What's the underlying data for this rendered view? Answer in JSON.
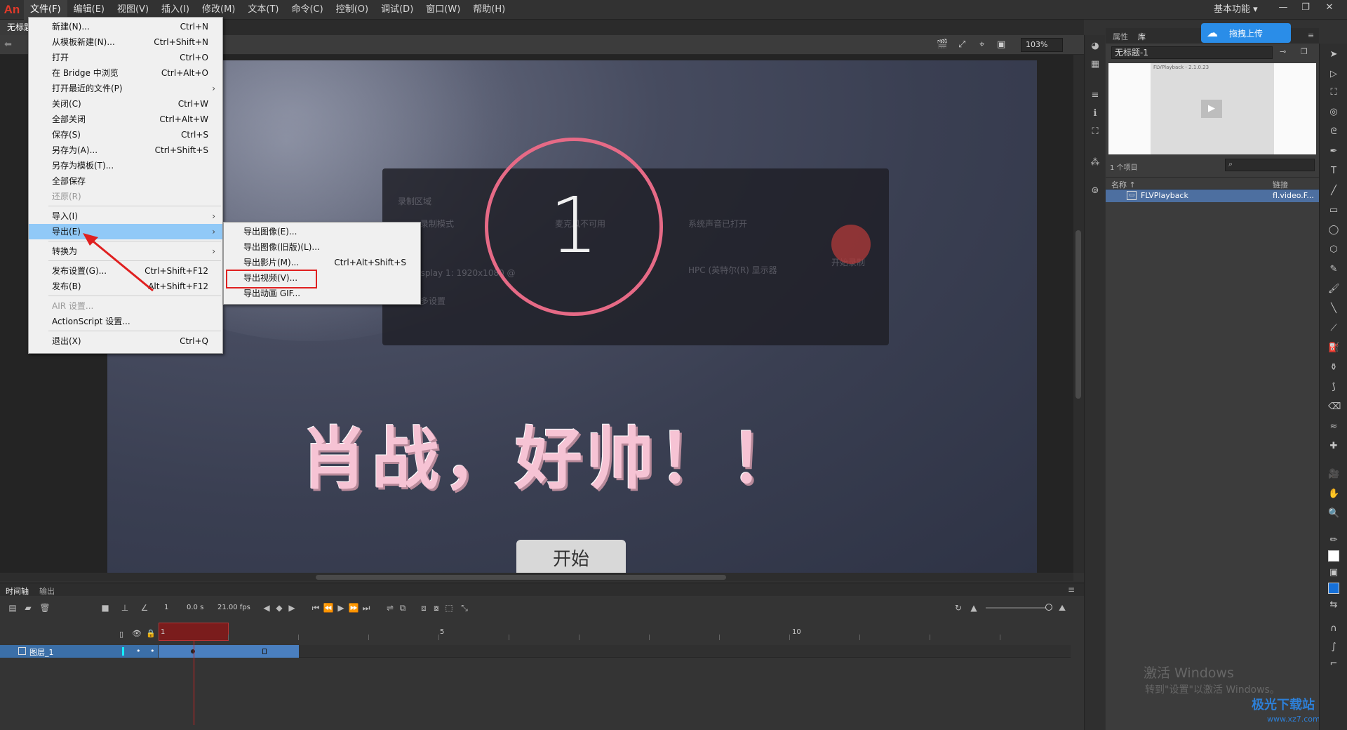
{
  "app": {
    "logo": "An"
  },
  "menubar": {
    "items": [
      "文件(F)",
      "编辑(E)",
      "视图(V)",
      "插入(I)",
      "修改(M)",
      "文本(T)",
      "命令(C)",
      "控制(O)",
      "调试(D)",
      "窗口(W)",
      "帮助(H)"
    ],
    "workspace": "基本功能",
    "workspace_arrow": "▾"
  },
  "document": {
    "tab_title": "无标题-1",
    "zoom": "103%"
  },
  "file_menu": {
    "items": [
      {
        "label": "新建(N)...",
        "shortcut": "Ctrl+N"
      },
      {
        "label": "从模板新建(N)...",
        "shortcut": "Ctrl+Shift+N"
      },
      {
        "label": "打开",
        "shortcut": "Ctrl+O"
      },
      {
        "label": "在 Bridge 中浏览",
        "shortcut": "Ctrl+Alt+O"
      },
      {
        "label": "打开最近的文件(P)",
        "shortcut": ""
      },
      {
        "label": "关闭(C)",
        "shortcut": "Ctrl+W"
      },
      {
        "label": "全部关闭",
        "shortcut": "Ctrl+Alt+W"
      },
      {
        "label": "保存(S)",
        "shortcut": "Ctrl+S"
      },
      {
        "label": "另存为(A)...",
        "shortcut": "Ctrl+Shift+S"
      },
      {
        "label": "另存为模板(T)...",
        "shortcut": ""
      },
      {
        "label": "全部保存",
        "shortcut": ""
      },
      {
        "label": "还原(R)",
        "shortcut": ""
      },
      {
        "label": "导入(I)",
        "shortcut": ""
      },
      {
        "label": "导出(E)",
        "shortcut": ""
      },
      {
        "label": "转换为",
        "shortcut": ""
      },
      {
        "label": "发布设置(G)...",
        "shortcut": "Ctrl+Shift+F12"
      },
      {
        "label": "发布(B)",
        "shortcut": "Alt+Shift+F12"
      },
      {
        "label": "AIR 设置...",
        "shortcut": ""
      },
      {
        "label": "ActionScript 设置...",
        "shortcut": ""
      },
      {
        "label": "退出(X)",
        "shortcut": "Ctrl+Q"
      }
    ],
    "submenu_arrow": "›"
  },
  "export_menu": {
    "items": [
      {
        "label": "导出图像(E)...",
        "shortcut": ""
      },
      {
        "label": "导出图像(旧版)(L)...",
        "shortcut": ""
      },
      {
        "label": "导出影片(M)...",
        "shortcut": "Ctrl+Alt+Shift+S"
      },
      {
        "label": "导出视频(V)...",
        "shortcut": ""
      },
      {
        "label": "导出动画 GIF...",
        "shortcut": ""
      }
    ]
  },
  "stage": {
    "countdown": "1",
    "hero_text": "肖战，好帅！！",
    "start_button": "开始",
    "bg_panel_text": [
      "录制区域",
      "录制模式",
      "麦克风不可用",
      "系统声音已打开",
      "开始录制",
      "更多设置",
      "Display 1: 1920x1080 @",
      "HPC (英特尔(R) 显示器"
    ]
  },
  "library": {
    "tabs": [
      "属性",
      "库"
    ],
    "upload_label": "拖拽上传",
    "doc_select": "无标题-1",
    "preview_title": "FLVPlayback - 2.1.0.23",
    "item_count": "1 个项目",
    "col_name": "名称 ↑",
    "col_link": "链接",
    "rows": [
      {
        "name": "FLVPlayback",
        "link": "fl.video.F..."
      }
    ]
  },
  "activation": {
    "title": "激活 Windows",
    "subtitle": "转到\"设置\"以激活 Windows。"
  },
  "watermark": {
    "main": "极光下载站",
    "sub": "www.xz7.com"
  },
  "timeline": {
    "tabs": [
      "时间轴",
      "输出"
    ],
    "frame": "1",
    "time": "0.0 s",
    "fps": "21.00 fps",
    "ruler_labels": [
      "1",
      "5",
      "10"
    ],
    "layer_name": "图层_1"
  },
  "colors": {
    "accent": "#2a8de8",
    "menu_highlight": "#91c9f7",
    "annotation_red": "#e02020",
    "hero_pink": "#f6c3d4",
    "ring": "#e66a86"
  }
}
